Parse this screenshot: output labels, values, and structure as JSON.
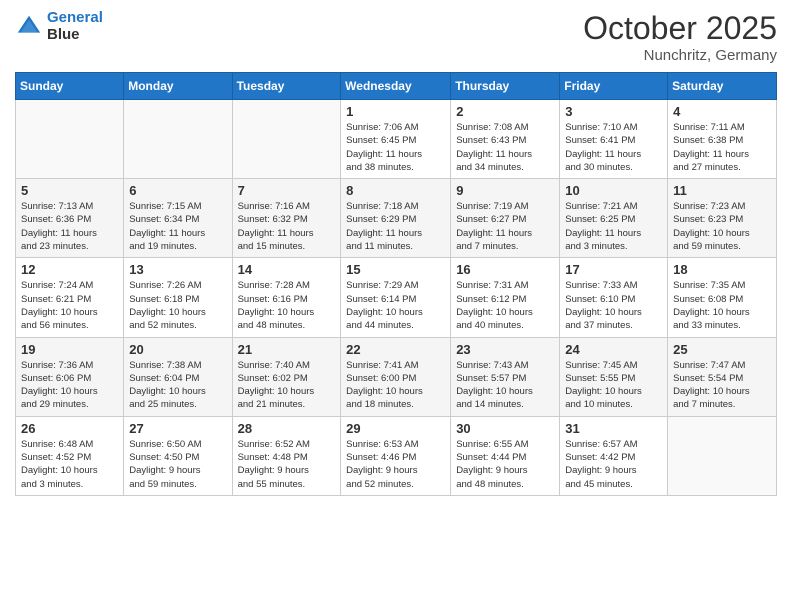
{
  "header": {
    "logo_line1": "General",
    "logo_line2": "Blue",
    "month": "October 2025",
    "location": "Nunchritz, Germany"
  },
  "weekdays": [
    "Sunday",
    "Monday",
    "Tuesday",
    "Wednesday",
    "Thursday",
    "Friday",
    "Saturday"
  ],
  "weeks": [
    {
      "days": [
        {
          "num": "",
          "info": ""
        },
        {
          "num": "",
          "info": ""
        },
        {
          "num": "",
          "info": ""
        },
        {
          "num": "1",
          "info": "Sunrise: 7:06 AM\nSunset: 6:45 PM\nDaylight: 11 hours\nand 38 minutes."
        },
        {
          "num": "2",
          "info": "Sunrise: 7:08 AM\nSunset: 6:43 PM\nDaylight: 11 hours\nand 34 minutes."
        },
        {
          "num": "3",
          "info": "Sunrise: 7:10 AM\nSunset: 6:41 PM\nDaylight: 11 hours\nand 30 minutes."
        },
        {
          "num": "4",
          "info": "Sunrise: 7:11 AM\nSunset: 6:38 PM\nDaylight: 11 hours\nand 27 minutes."
        }
      ]
    },
    {
      "days": [
        {
          "num": "5",
          "info": "Sunrise: 7:13 AM\nSunset: 6:36 PM\nDaylight: 11 hours\nand 23 minutes."
        },
        {
          "num": "6",
          "info": "Sunrise: 7:15 AM\nSunset: 6:34 PM\nDaylight: 11 hours\nand 19 minutes."
        },
        {
          "num": "7",
          "info": "Sunrise: 7:16 AM\nSunset: 6:32 PM\nDaylight: 11 hours\nand 15 minutes."
        },
        {
          "num": "8",
          "info": "Sunrise: 7:18 AM\nSunset: 6:29 PM\nDaylight: 11 hours\nand 11 minutes."
        },
        {
          "num": "9",
          "info": "Sunrise: 7:19 AM\nSunset: 6:27 PM\nDaylight: 11 hours\nand 7 minutes."
        },
        {
          "num": "10",
          "info": "Sunrise: 7:21 AM\nSunset: 6:25 PM\nDaylight: 11 hours\nand 3 minutes."
        },
        {
          "num": "11",
          "info": "Sunrise: 7:23 AM\nSunset: 6:23 PM\nDaylight: 10 hours\nand 59 minutes."
        }
      ]
    },
    {
      "days": [
        {
          "num": "12",
          "info": "Sunrise: 7:24 AM\nSunset: 6:21 PM\nDaylight: 10 hours\nand 56 minutes."
        },
        {
          "num": "13",
          "info": "Sunrise: 7:26 AM\nSunset: 6:18 PM\nDaylight: 10 hours\nand 52 minutes."
        },
        {
          "num": "14",
          "info": "Sunrise: 7:28 AM\nSunset: 6:16 PM\nDaylight: 10 hours\nand 48 minutes."
        },
        {
          "num": "15",
          "info": "Sunrise: 7:29 AM\nSunset: 6:14 PM\nDaylight: 10 hours\nand 44 minutes."
        },
        {
          "num": "16",
          "info": "Sunrise: 7:31 AM\nSunset: 6:12 PM\nDaylight: 10 hours\nand 40 minutes."
        },
        {
          "num": "17",
          "info": "Sunrise: 7:33 AM\nSunset: 6:10 PM\nDaylight: 10 hours\nand 37 minutes."
        },
        {
          "num": "18",
          "info": "Sunrise: 7:35 AM\nSunset: 6:08 PM\nDaylight: 10 hours\nand 33 minutes."
        }
      ]
    },
    {
      "days": [
        {
          "num": "19",
          "info": "Sunrise: 7:36 AM\nSunset: 6:06 PM\nDaylight: 10 hours\nand 29 minutes."
        },
        {
          "num": "20",
          "info": "Sunrise: 7:38 AM\nSunset: 6:04 PM\nDaylight: 10 hours\nand 25 minutes."
        },
        {
          "num": "21",
          "info": "Sunrise: 7:40 AM\nSunset: 6:02 PM\nDaylight: 10 hours\nand 21 minutes."
        },
        {
          "num": "22",
          "info": "Sunrise: 7:41 AM\nSunset: 6:00 PM\nDaylight: 10 hours\nand 18 minutes."
        },
        {
          "num": "23",
          "info": "Sunrise: 7:43 AM\nSunset: 5:57 PM\nDaylight: 10 hours\nand 14 minutes."
        },
        {
          "num": "24",
          "info": "Sunrise: 7:45 AM\nSunset: 5:55 PM\nDaylight: 10 hours\nand 10 minutes."
        },
        {
          "num": "25",
          "info": "Sunrise: 7:47 AM\nSunset: 5:54 PM\nDaylight: 10 hours\nand 7 minutes."
        }
      ]
    },
    {
      "days": [
        {
          "num": "26",
          "info": "Sunrise: 6:48 AM\nSunset: 4:52 PM\nDaylight: 10 hours\nand 3 minutes."
        },
        {
          "num": "27",
          "info": "Sunrise: 6:50 AM\nSunset: 4:50 PM\nDaylight: 9 hours\nand 59 minutes."
        },
        {
          "num": "28",
          "info": "Sunrise: 6:52 AM\nSunset: 4:48 PM\nDaylight: 9 hours\nand 55 minutes."
        },
        {
          "num": "29",
          "info": "Sunrise: 6:53 AM\nSunset: 4:46 PM\nDaylight: 9 hours\nand 52 minutes."
        },
        {
          "num": "30",
          "info": "Sunrise: 6:55 AM\nSunset: 4:44 PM\nDaylight: 9 hours\nand 48 minutes."
        },
        {
          "num": "31",
          "info": "Sunrise: 6:57 AM\nSunset: 4:42 PM\nDaylight: 9 hours\nand 45 minutes."
        },
        {
          "num": "",
          "info": ""
        }
      ]
    }
  ]
}
